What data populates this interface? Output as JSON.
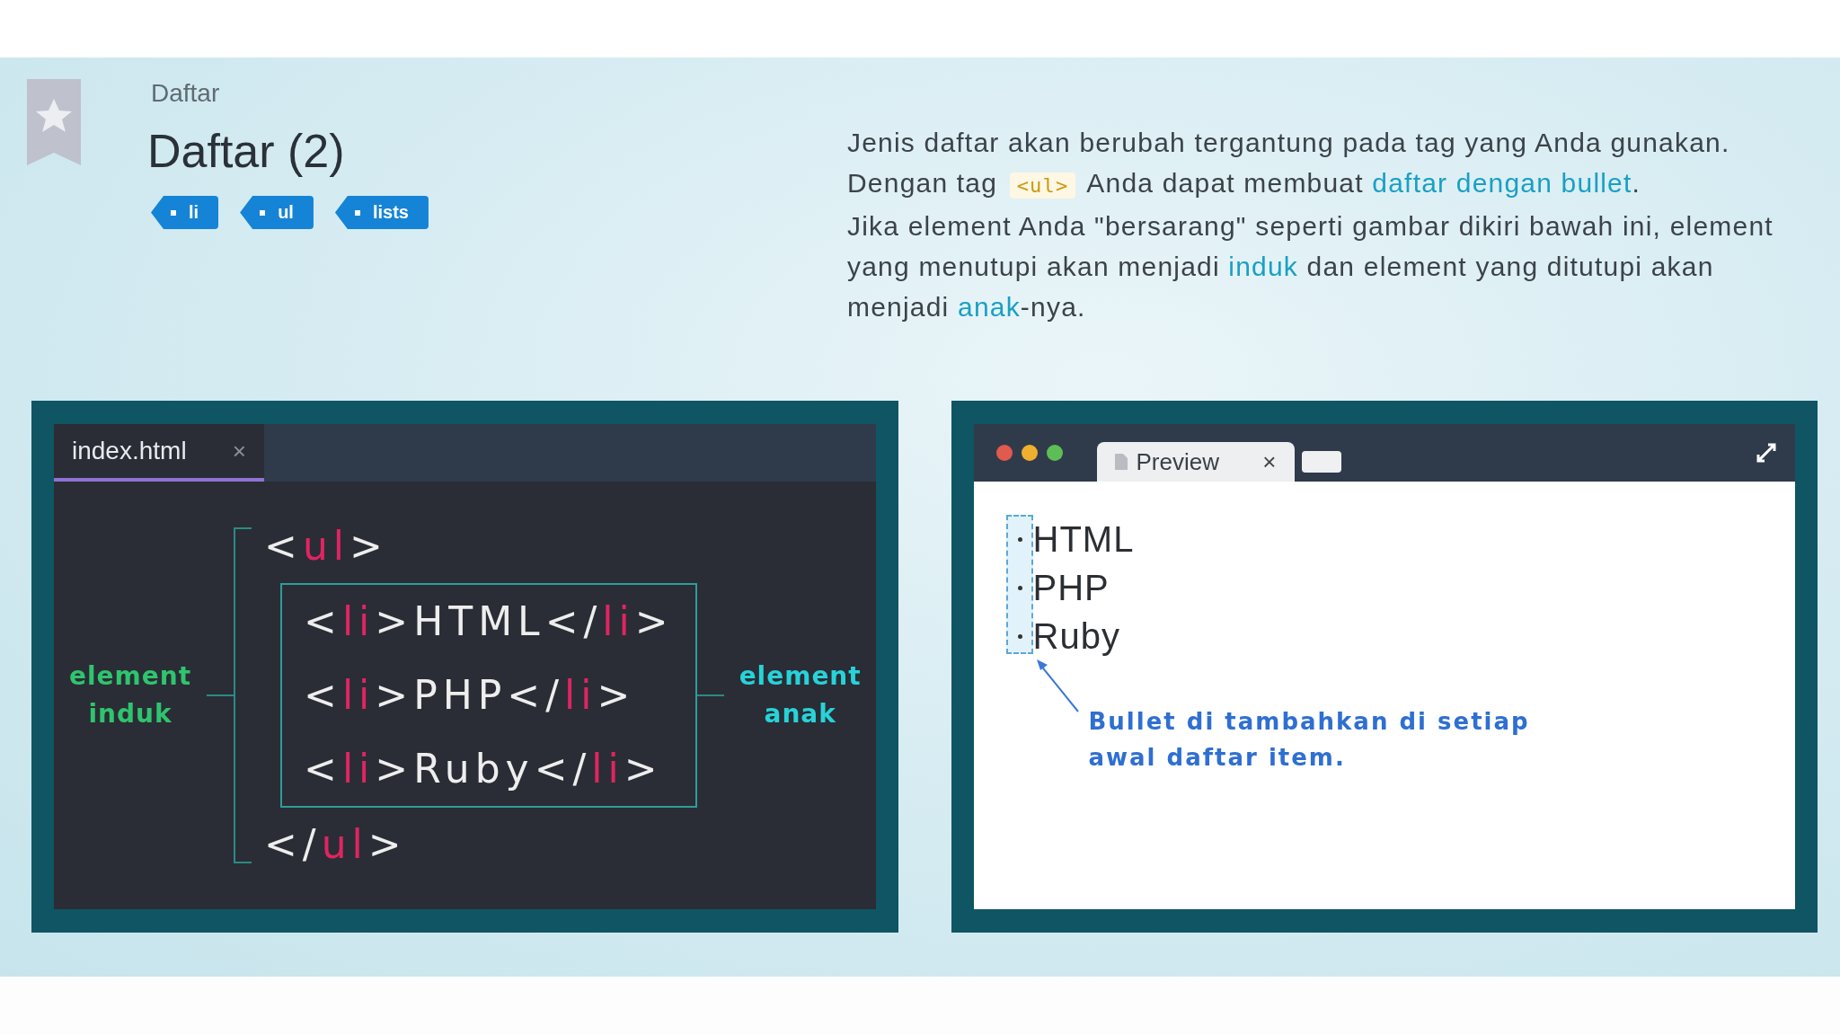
{
  "header": {
    "breadcrumb": "Daftar",
    "title": "Daftar (2)",
    "tags": [
      "li",
      "ul",
      "lists"
    ]
  },
  "description": [
    [
      {
        "kind": "plain",
        "text": "Jenis daftar akan berubah tergantung pada tag yang Anda gunakan. Dengan tag "
      },
      {
        "kind": "code",
        "text": "<ul>"
      },
      {
        "kind": "plain",
        "text": " Anda dapat membuat "
      },
      {
        "kind": "term",
        "text": "daftar dengan bullet"
      },
      {
        "kind": "plain",
        "text": "."
      }
    ],
    [
      {
        "kind": "plain",
        "text": "Jika element Anda \"bersarang\" seperti gambar dikiri bawah ini, element yang menutupi akan menjadi "
      },
      {
        "kind": "term",
        "text": "induk"
      },
      {
        "kind": "plain",
        "text": " dan element yang ditutupi akan menjadi "
      },
      {
        "kind": "term",
        "text": "anak"
      },
      {
        "kind": "plain",
        "text": "-nya."
      }
    ]
  ],
  "editor": {
    "tab": {
      "label": "index.html",
      "close": "×",
      "selected": true
    },
    "parent_label": "element induk",
    "child_label": "element anak",
    "open": [
      {
        "kind": "punct",
        "text": "<"
      },
      {
        "kind": "tag",
        "text": "ul"
      },
      {
        "kind": "punct",
        "text": ">"
      }
    ],
    "children": [
      [
        {
          "kind": "punct",
          "text": "<"
        },
        {
          "kind": "tag",
          "text": "li"
        },
        {
          "kind": "punct",
          "text": ">HTML</"
        },
        {
          "kind": "tag",
          "text": "li"
        },
        {
          "kind": "punct",
          "text": ">"
        }
      ],
      [
        {
          "kind": "punct",
          "text": "<"
        },
        {
          "kind": "tag",
          "text": "li"
        },
        {
          "kind": "punct",
          "text": ">PHP</"
        },
        {
          "kind": "tag",
          "text": "li"
        },
        {
          "kind": "punct",
          "text": ">"
        }
      ],
      [
        {
          "kind": "punct",
          "text": "<"
        },
        {
          "kind": "tag",
          "text": "li"
        },
        {
          "kind": "punct",
          "text": ">Ruby</"
        },
        {
          "kind": "tag",
          "text": "li"
        },
        {
          "kind": "punct",
          "text": ">"
        }
      ]
    ],
    "close": [
      {
        "kind": "punct",
        "text": "</"
      },
      {
        "kind": "tag",
        "text": "ul"
      },
      {
        "kind": "punct",
        "text": ">"
      }
    ]
  },
  "preview": {
    "tab": {
      "label": "Preview",
      "close": "×"
    },
    "items": [
      "HTML",
      "PHP",
      "Ruby"
    ],
    "note": "Bullet di tambahkan di setiap awal daftar item."
  }
}
